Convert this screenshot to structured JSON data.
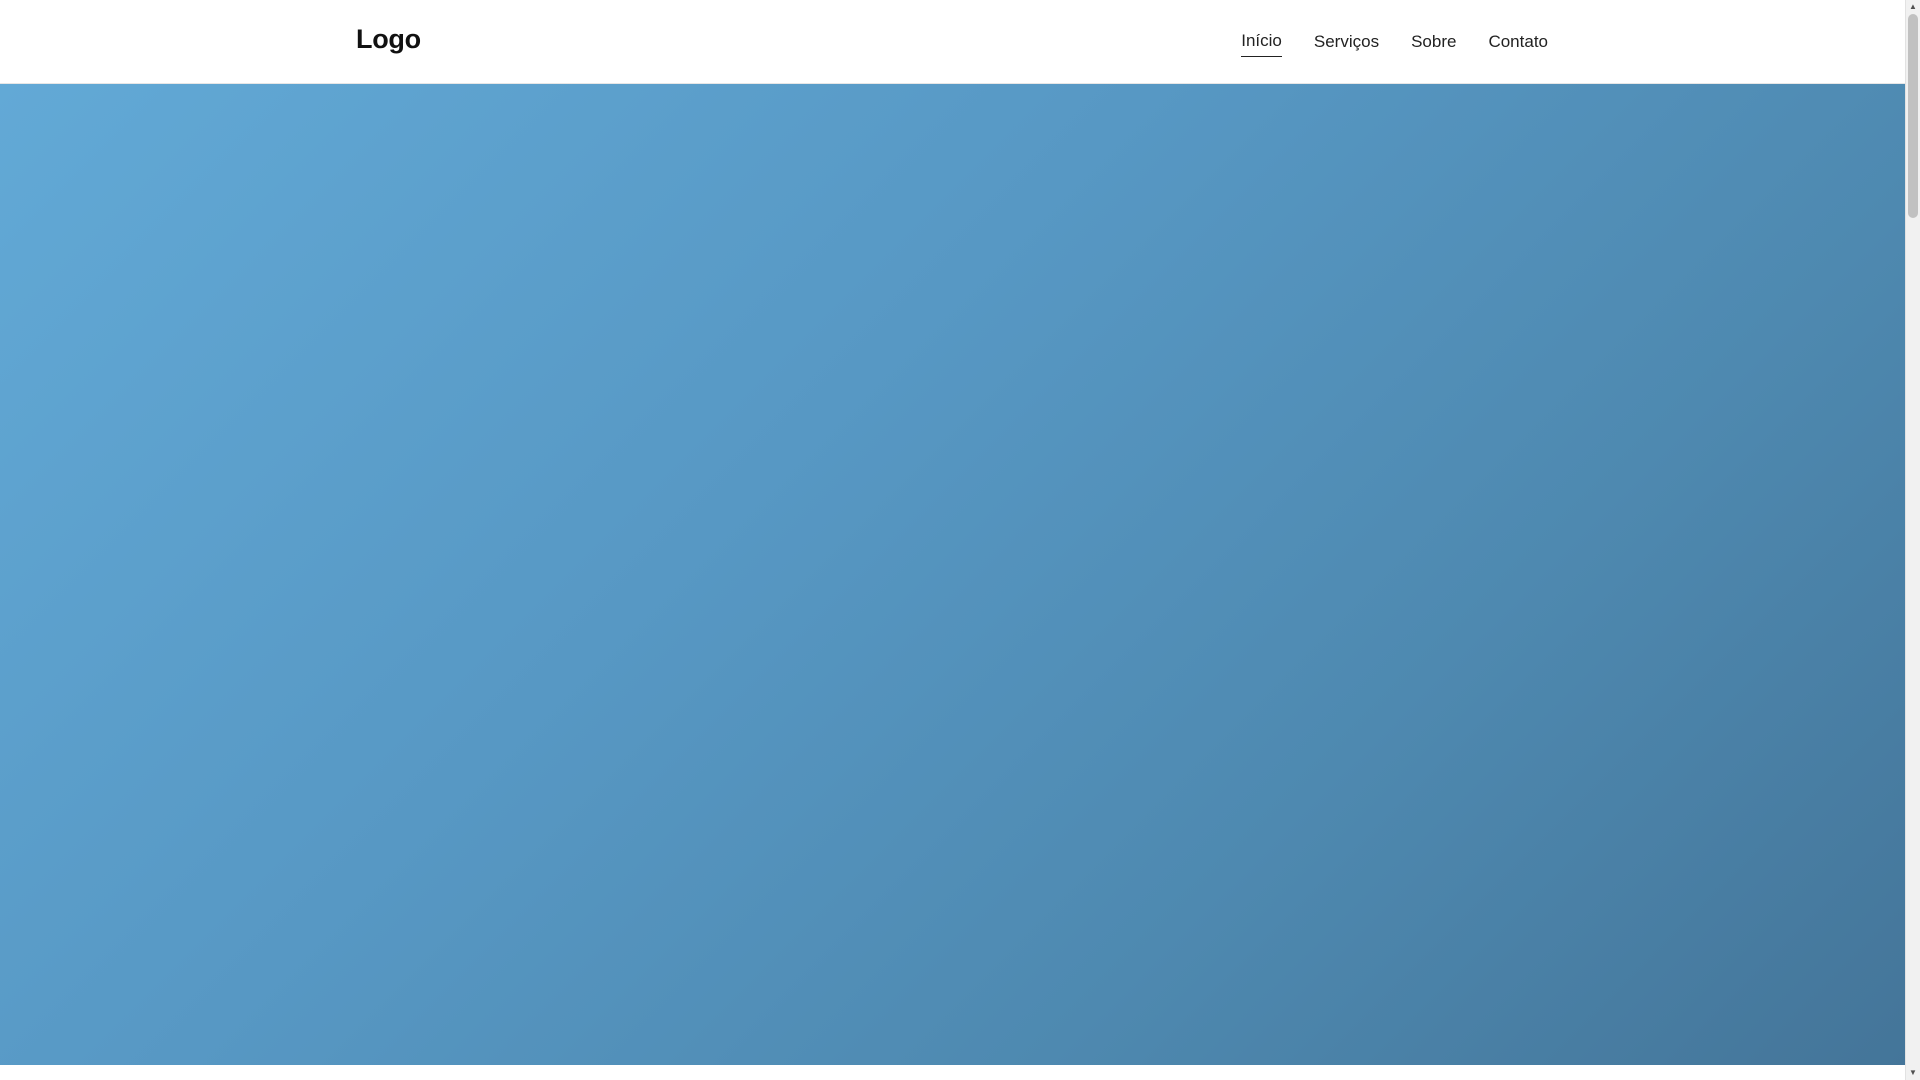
{
  "header": {
    "logo": "Logo",
    "nav": [
      {
        "label": "Início",
        "active": true
      },
      {
        "label": "Serviços",
        "active": false
      },
      {
        "label": "Sobre",
        "active": false
      },
      {
        "label": "Contato",
        "active": false
      }
    ]
  },
  "hero": {
    "gradient_colors": [
      "#62a9d6",
      "#5798c4",
      "#4e89b0",
      "#447599"
    ]
  },
  "scrollbar": {
    "up_icon": "triangle-up-icon",
    "down_icon": "triangle-down-icon"
  }
}
